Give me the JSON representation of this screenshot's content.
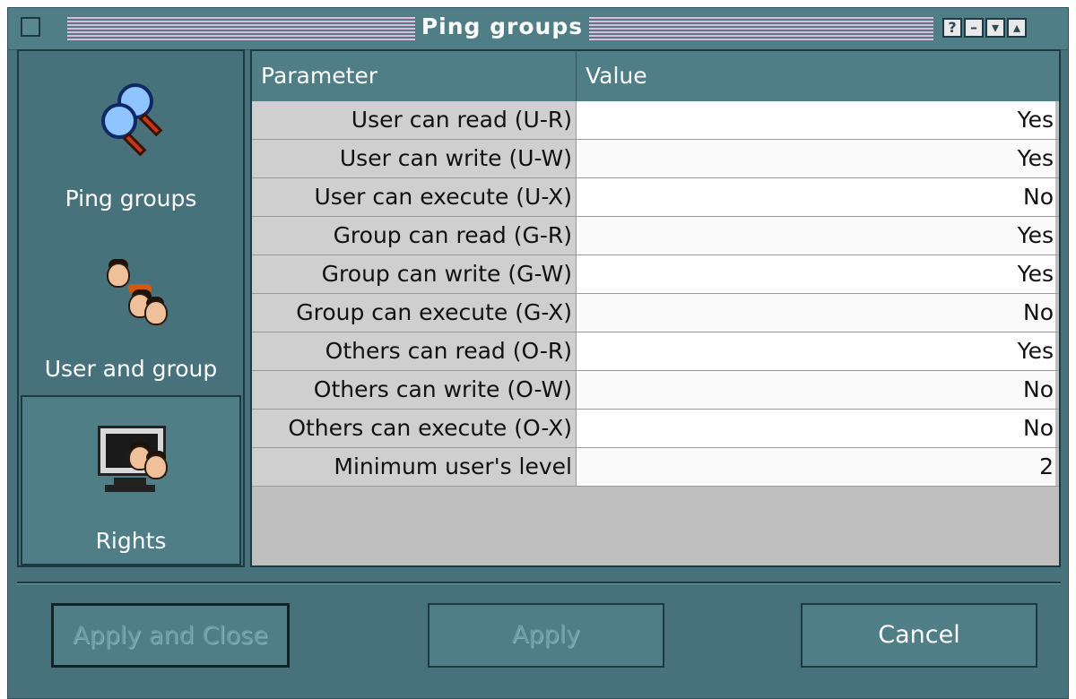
{
  "window": {
    "title": "Ping groups",
    "title_buttons": [
      "?",
      "–",
      "▾",
      "▴"
    ]
  },
  "sidebar": {
    "items": [
      {
        "label": "Ping groups",
        "icon": "magnifier-icon"
      },
      {
        "label": "User and group",
        "icon": "users-icon"
      },
      {
        "label": "Rights",
        "icon": "monitor-users-icon"
      }
    ],
    "active_index": 2
  },
  "table": {
    "headers": [
      "Parameter",
      "Value"
    ],
    "rows": [
      {
        "param": "User can read (U-R)",
        "value": "Yes"
      },
      {
        "param": "User can write (U-W)",
        "value": "Yes"
      },
      {
        "param": "User can execute (U-X)",
        "value": "No"
      },
      {
        "param": "Group can read (G-R)",
        "value": "Yes"
      },
      {
        "param": "Group can write (G-W)",
        "value": "Yes"
      },
      {
        "param": "Group can execute (G-X)",
        "value": "No"
      },
      {
        "param": "Others can read (O-R)",
        "value": "Yes"
      },
      {
        "param": "Others can write (O-W)",
        "value": "No"
      },
      {
        "param": "Others can execute (O-X)",
        "value": "No"
      },
      {
        "param": "Minimum user's level",
        "value": "2"
      }
    ]
  },
  "buttons": {
    "apply_close": "Apply and Close",
    "apply": "Apply",
    "cancel": "Cancel"
  },
  "colors": {
    "window_bg": "#47727c",
    "titlebar_stripe": "#e2b8e3",
    "header_bg": "#4f7e87"
  }
}
